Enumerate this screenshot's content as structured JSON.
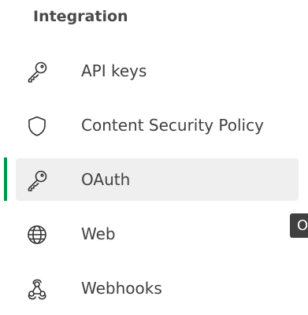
{
  "section": {
    "title": "Integration"
  },
  "nav": {
    "items": [
      {
        "label": "API keys",
        "icon": "key-icon",
        "active": false
      },
      {
        "label": "Content Security Policy",
        "icon": "shield-icon",
        "active": false
      },
      {
        "label": "OAuth",
        "icon": "key-icon",
        "active": true
      },
      {
        "label": "Web",
        "icon": "globe-icon",
        "active": false
      },
      {
        "label": "Webhooks",
        "icon": "webhook-icon",
        "active": false
      }
    ]
  },
  "tooltip": {
    "text": "O"
  },
  "colors": {
    "active_indicator": "#009845",
    "active_background": "#efefef",
    "text": "#404040",
    "tooltip_background": "#404040"
  }
}
